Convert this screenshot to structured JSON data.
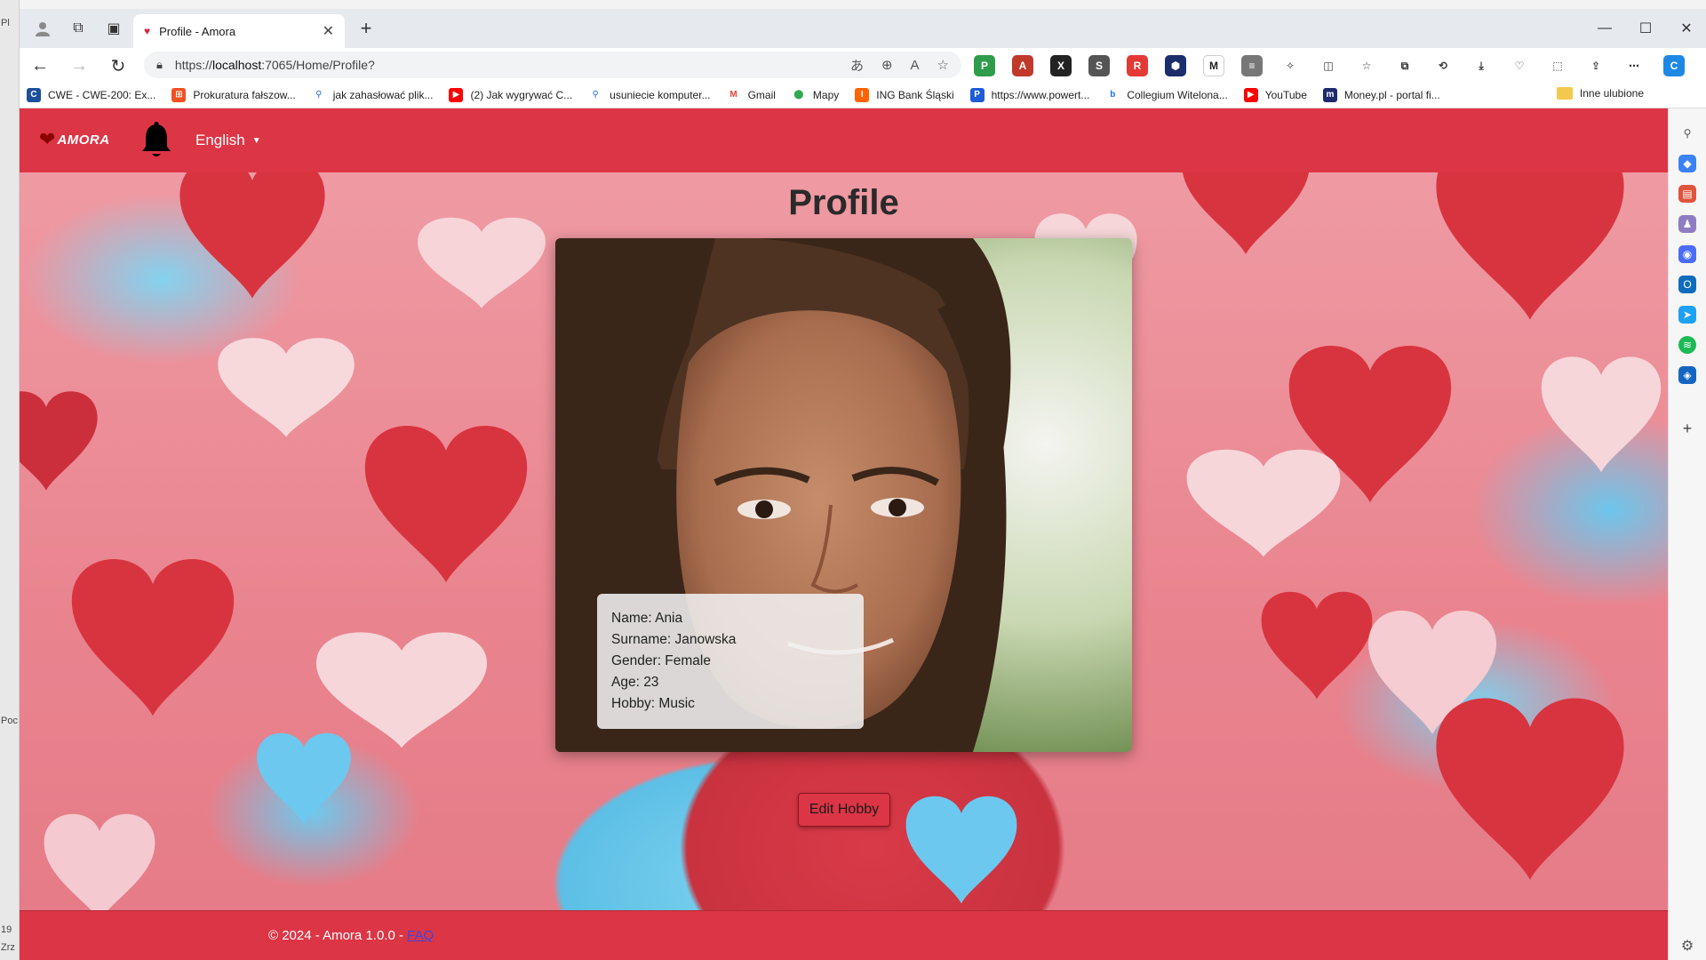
{
  "left_strip": {
    "labels": [
      "Pl",
      "Poc",
      "19",
      "Zrz"
    ]
  },
  "browser": {
    "tab": {
      "title": "Profile - Amora"
    },
    "address": {
      "prefix": "https://",
      "host": "localhost",
      "path": ":7065/Home/Profile?"
    },
    "bookmarks": [
      {
        "label": "CWE - CWE-200: Ex...",
        "icon": "cwe-icon",
        "color": "#1b4f9c"
      },
      {
        "label": "Prokuratura fałszow...",
        "icon": "windows-icon",
        "color": "#f25022"
      },
      {
        "label": "jak zahasłować plik...",
        "icon": "search-icon",
        "color": "#2a6fd6"
      },
      {
        "label": "(2) Jak wygrywać C...",
        "icon": "youtube-icon",
        "color": "#ff0000"
      },
      {
        "label": "usuniecie komputer...",
        "icon": "search-icon",
        "color": "#2a6fd6"
      },
      {
        "label": "Gmail",
        "icon": "gmail-icon",
        "color": "#ea4335"
      },
      {
        "label": "Mapy",
        "icon": "maps-icon",
        "color": "#34a853"
      },
      {
        "label": "ING Bank Śląski",
        "icon": "ing-icon",
        "color": "#ff6200"
      },
      {
        "label": "https://www.powert...",
        "icon": "powertoys-icon",
        "color": "#1f5cd6"
      },
      {
        "label": "Collegium Witelona...",
        "icon": "bing-icon",
        "color": "#1a73e8"
      },
      {
        "label": "YouTube",
        "icon": "youtube-icon",
        "color": "#ff0000"
      },
      {
        "label": "Money.pl - portal fi...",
        "icon": "money-icon",
        "color": "#1d2b6b"
      }
    ],
    "other_favorites": "Inne ulubione"
  },
  "app": {
    "brand": "AMORA",
    "language": "English",
    "page_title": "Profile",
    "profile": {
      "name": "Name: Ania",
      "surname": "Surname: Janowska",
      "gender": "Gender: Female",
      "age": "Age: 23",
      "hobby": "Hobby: Music"
    },
    "edit_button": "Edit Hobby",
    "footer": {
      "text": "© 2024 - Amora 1.0.0 - ",
      "link": "FAQ"
    },
    "colors": {
      "primary": "#dc3545",
      "brand_dark": "#8b0000"
    }
  }
}
